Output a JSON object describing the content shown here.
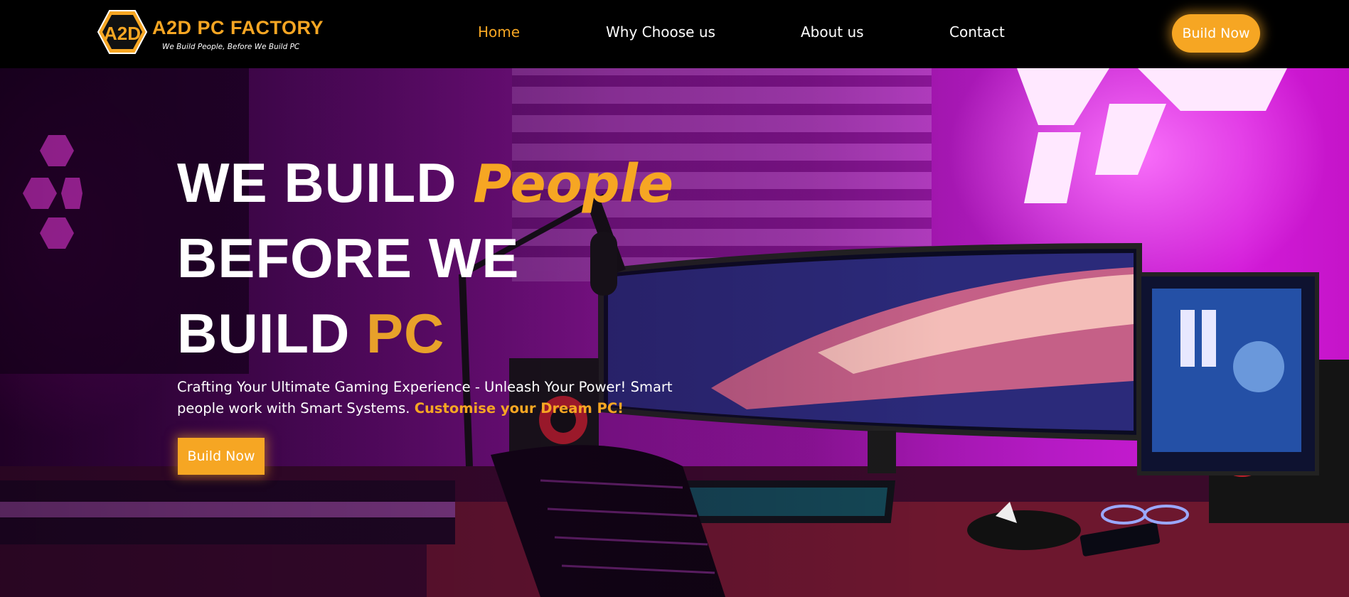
{
  "brand": {
    "name": "A2D PC FACTORY",
    "tagline": "We Build People, Before We Build PC",
    "badge_text": "A2D"
  },
  "nav": {
    "items": [
      {
        "label": "Home",
        "active": true
      },
      {
        "label": "Why Choose us",
        "active": false
      },
      {
        "label": "About us",
        "active": false
      },
      {
        "label": "Contact",
        "active": false
      }
    ],
    "cta_label": "Build Now"
  },
  "hero": {
    "headline": {
      "line1_prefix": "WE BUILD ",
      "line1_accent": "People",
      "line2": "BEFORE WE",
      "line3_prefix": "BUILD ",
      "line3_accent": "PC"
    },
    "subtext": "Crafting Your Ultimate Gaming Experience - Unleash Your Power! Smart people work with Smart Systems. ",
    "subtext_highlight": "Customise your Dream PC!",
    "cta_label": "Build Now"
  },
  "colors": {
    "accent": "#f6a623",
    "background": "#000000",
    "hero_tint": "#8f1399"
  }
}
